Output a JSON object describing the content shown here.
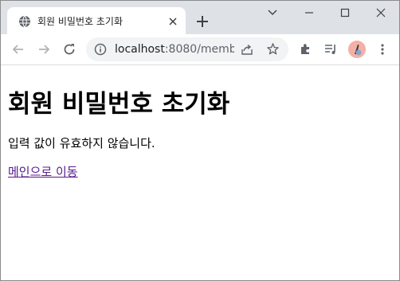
{
  "browser": {
    "tab": {
      "title": "회원 비밀번호 초기화"
    },
    "address_bar": {
      "host": "localhost",
      "rest": ":8080/memb..."
    }
  },
  "page": {
    "heading": "회원 비밀번호 초기화",
    "message": "입력 값이 유효하지 않습니다.",
    "link_text": "메인으로 이동"
  },
  "colors": {
    "tabstrip_bg": "#dee1e6",
    "visited_link": "#551a8b",
    "avatar_bg": "#f3b1a6"
  },
  "icons": [
    "globe-icon",
    "tab-close-icon",
    "new-tab-icon",
    "chevron-down-icon",
    "minimize-icon",
    "maximize-icon",
    "window-close-icon",
    "back-icon",
    "forward-icon",
    "reload-icon",
    "site-info-icon",
    "share-icon",
    "bookmark-star-icon",
    "extensions-icon",
    "media-queue-icon",
    "profile-avatar",
    "kebab-menu-icon"
  ]
}
